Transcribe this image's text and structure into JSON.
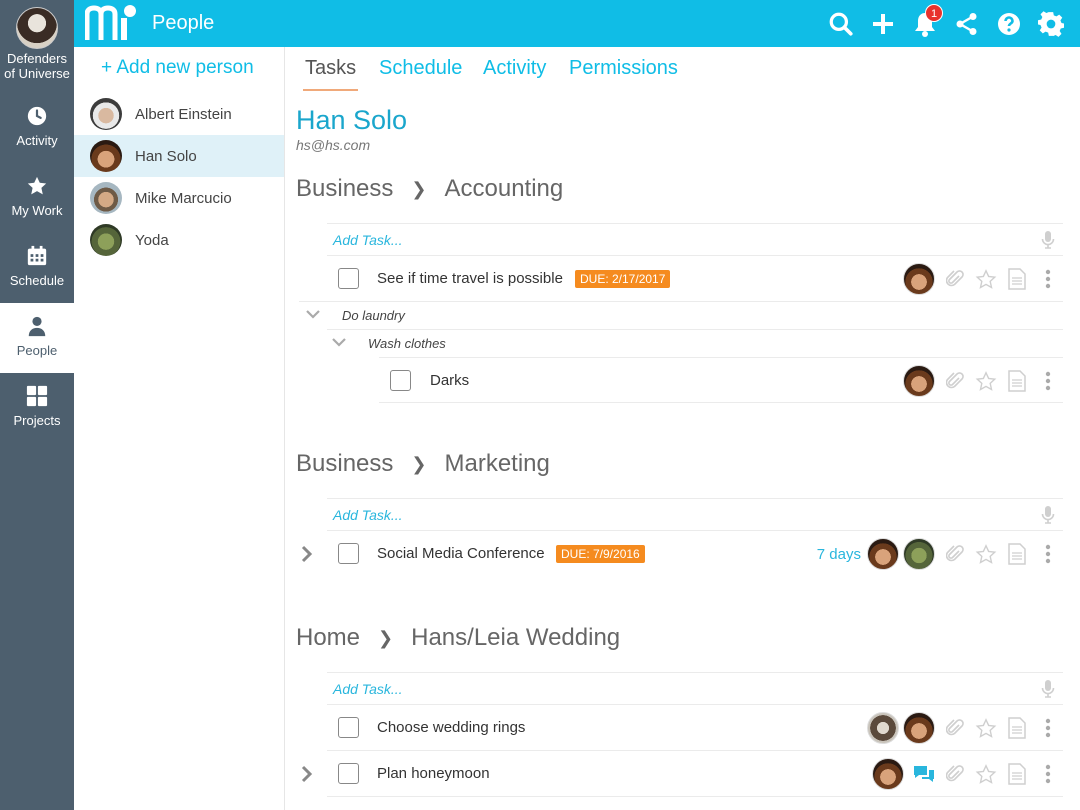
{
  "org": {
    "name_line1": "Defenders",
    "name_line2": "of Universe"
  },
  "rail": [
    {
      "label": "Activity",
      "icon": "clock-icon"
    },
    {
      "label": "My Work",
      "icon": "star-icon"
    },
    {
      "label": "Schedule",
      "icon": "calendar-icon"
    },
    {
      "label": "People",
      "icon": "person-icon",
      "active": true
    },
    {
      "label": "Projects",
      "icon": "grid-icon"
    }
  ],
  "topbar": {
    "title": "People",
    "notification_count": "1",
    "icons": [
      "search-icon",
      "plus-icon",
      "bell-icon",
      "share-icon",
      "help-icon",
      "gear-icon"
    ]
  },
  "people": {
    "add_label": "+ Add new person",
    "list": [
      {
        "name": "Albert Einstein"
      },
      {
        "name": "Han Solo",
        "active": true
      },
      {
        "name": "Mike Marcucio"
      },
      {
        "name": "Yoda"
      }
    ]
  },
  "tabs": [
    {
      "label": "Tasks",
      "active": true
    },
    {
      "label": "Schedule"
    },
    {
      "label": "Activity"
    },
    {
      "label": "Permissions"
    }
  ],
  "person": {
    "name": "Han Solo",
    "email": "hs@hs.com"
  },
  "sections": [
    {
      "crumb_a": "Business",
      "crumb_b": "Accounting",
      "add_task": "Add Task...",
      "task1": {
        "text": "See if time travel is possible",
        "due": "DUE: 2/17/2017"
      },
      "sub1": "Do laundry",
      "sub2": "Wash clothes",
      "task2": {
        "text": "Darks"
      }
    },
    {
      "crumb_a": "Business",
      "crumb_b": "Marketing",
      "add_task": "Add Task...",
      "task1": {
        "text": "Social Media Conference",
        "due": "DUE: 7/9/2016",
        "days": "7 days"
      }
    },
    {
      "crumb_a": "Home",
      "crumb_b": "Hans/Leia Wedding",
      "add_task": "Add Task...",
      "task1": {
        "text": "Choose wedding rings"
      },
      "task2": {
        "text": "Plan honeymoon"
      }
    }
  ],
  "colors": {
    "accent": "#10bde6",
    "rail": "#4d5f6e",
    "due": "#f58b1f",
    "badge": "#e8322d"
  }
}
